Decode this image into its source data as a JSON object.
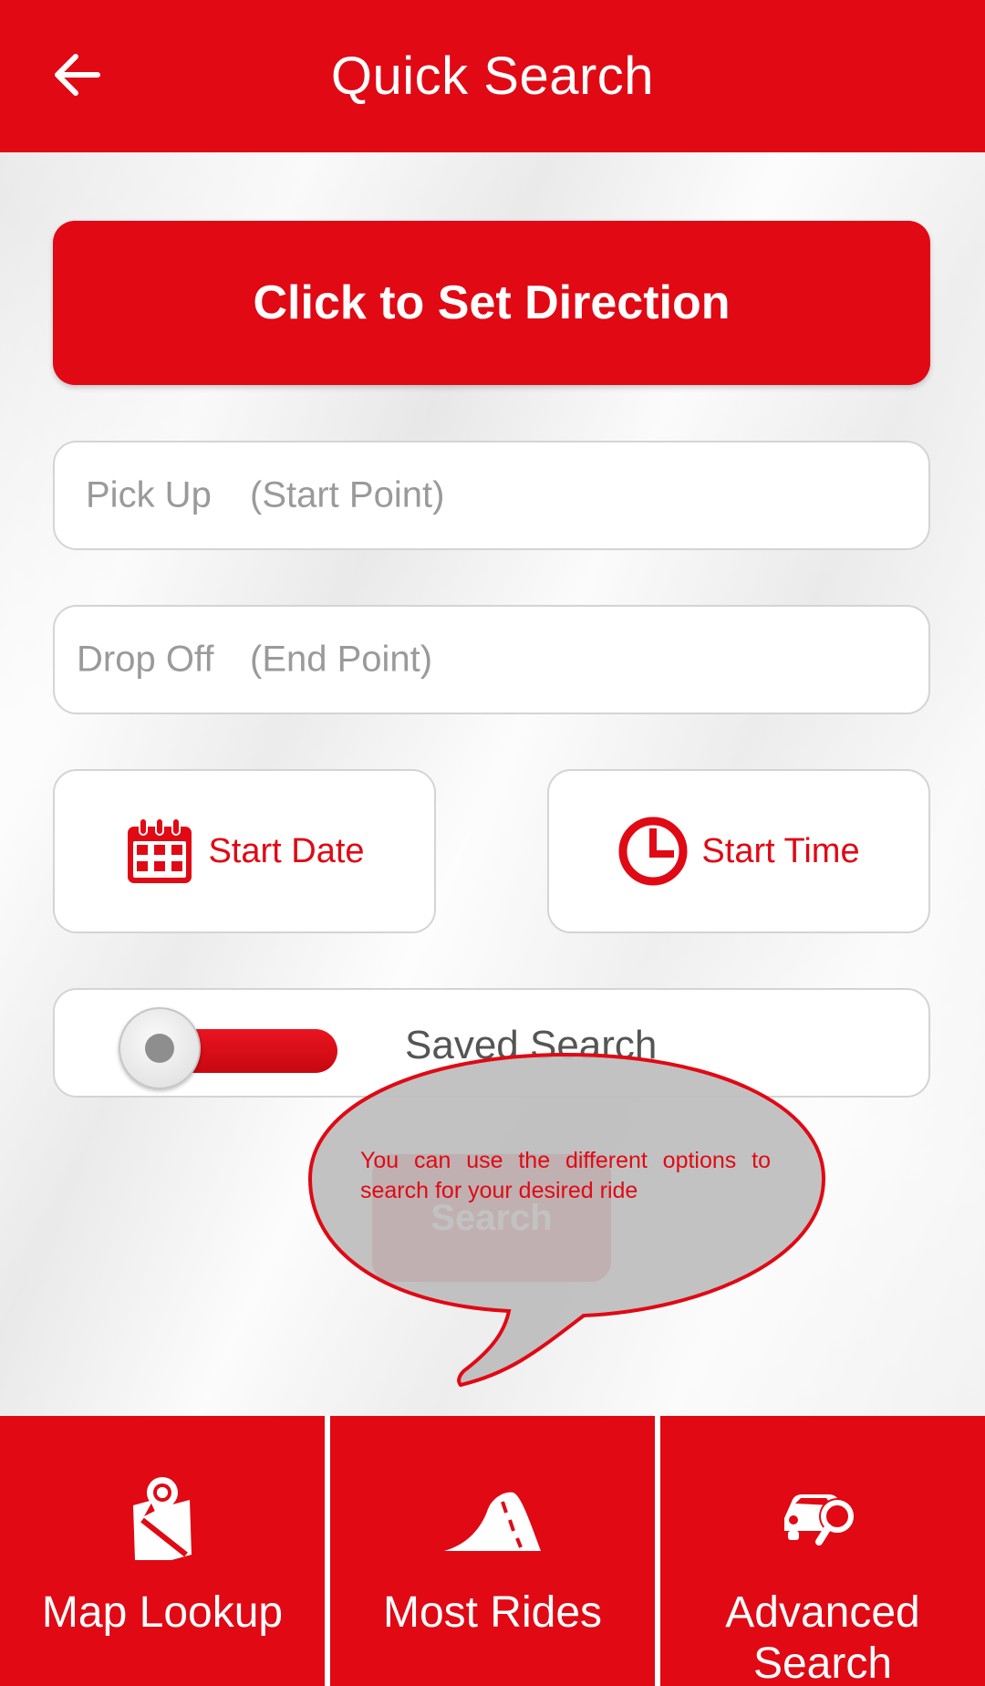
{
  "header": {
    "title": "Quick Search",
    "back_icon": "arrow-left-icon"
  },
  "direction_button": {
    "label": "Click to Set Direction"
  },
  "pickup": {
    "label": "Pick Up",
    "hint": "(Start Point)"
  },
  "dropoff": {
    "label": "Drop Off",
    "hint": "(End Point)"
  },
  "start_date": {
    "label": "Start Date",
    "icon": "calendar-icon"
  },
  "start_time": {
    "label": "Start Time",
    "icon": "clock-icon"
  },
  "saved_search": {
    "label": "Saved Search",
    "toggle_on": false
  },
  "search_button": {
    "label": "Search"
  },
  "tooltip": {
    "text": "You can use the different options to search for your desired ride"
  },
  "bottom_nav": {
    "items": [
      {
        "label": "Map Lookup",
        "icon": "map-pin-icon"
      },
      {
        "label": "Most Rides",
        "icon": "road-icon"
      },
      {
        "label": "Advanced Search",
        "icon": "car-search-icon"
      }
    ]
  },
  "colors": {
    "accent": "#e00914",
    "tooltip_fill": "#bdbdbd",
    "placeholder_text": "#9a9a9a"
  }
}
